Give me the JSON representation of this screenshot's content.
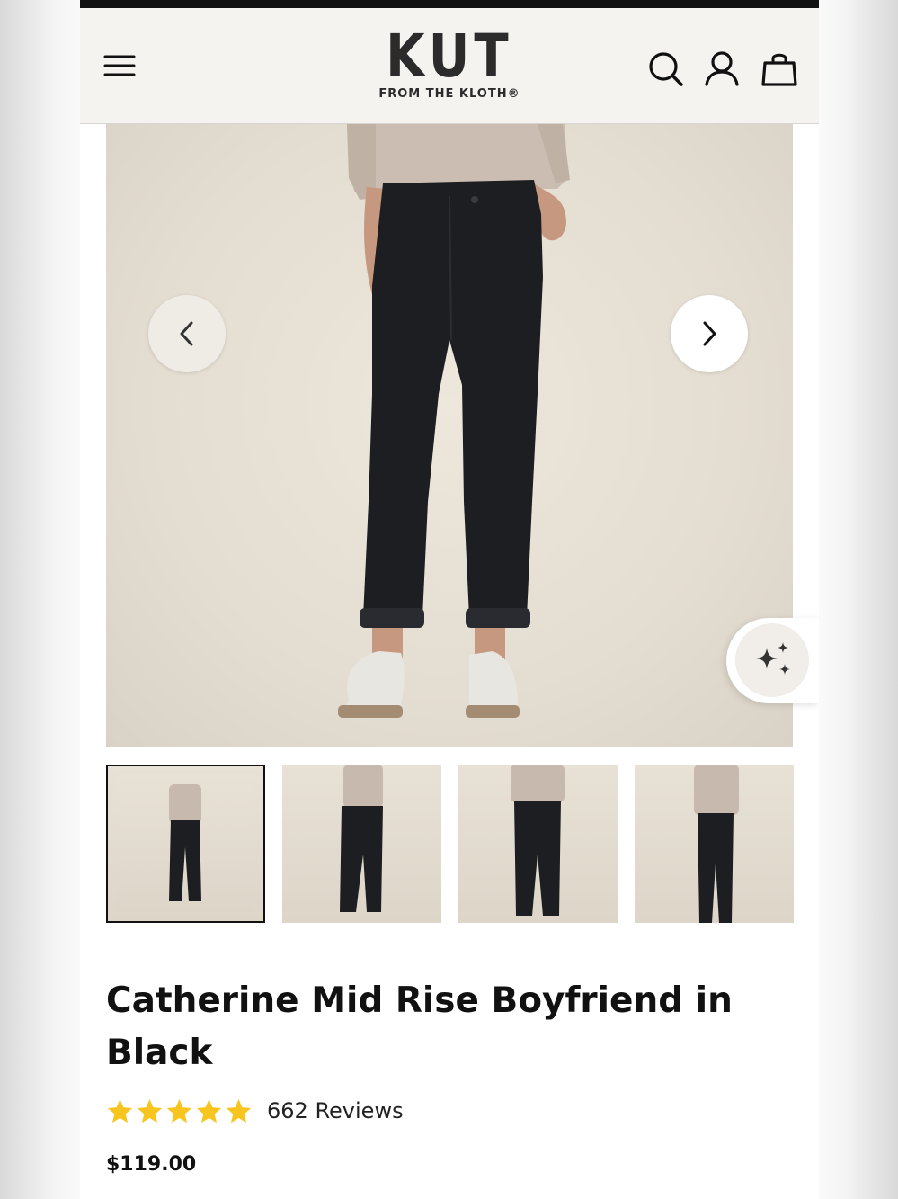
{
  "header": {
    "logo_main": "KUT",
    "logo_sub": "FROM THE KLOTH®"
  },
  "icons": {
    "menu": "hamburger-menu-icon",
    "search": "search-icon",
    "account": "user-icon",
    "bag": "shopping-bag-icon",
    "prev": "chevron-left-icon",
    "next": "chevron-right-icon",
    "ai": "sparkles-icon",
    "star": "star-icon"
  },
  "gallery": {
    "thumbnail_count": 4,
    "active_thumbnail": 1
  },
  "product": {
    "title": "Catherine Mid Rise Boyfriend in Black",
    "rating": 5,
    "reviews_label": "662 Reviews",
    "price": "$119.00"
  },
  "colors": {
    "star": "#f7c51e",
    "text": "#111111",
    "header_bg": "#f4f3f0"
  }
}
